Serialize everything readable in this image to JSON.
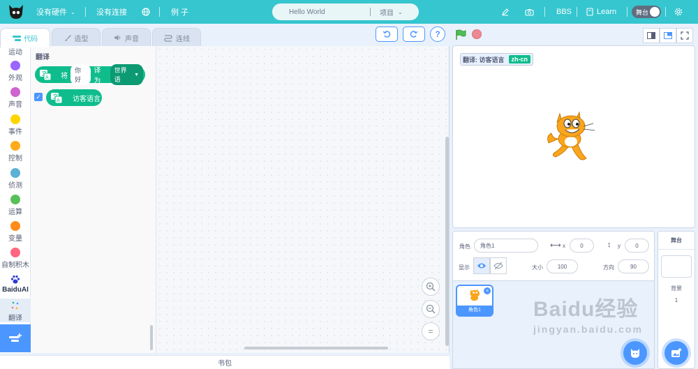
{
  "menu": {
    "hardware_label": "没有硬件",
    "connection_label": "没有连接",
    "examples_label": "例 子",
    "project_title": "Hello World",
    "project_menu_label": "项目",
    "bbs_label": "BBS",
    "learn_label": "Learn",
    "stage_toggle_label": "舞台"
  },
  "tabs": [
    {
      "label": "代码"
    },
    {
      "label": "造型"
    },
    {
      "label": "声音"
    },
    {
      "label": "连线"
    }
  ],
  "categories": [
    {
      "label": "运动",
      "color": "#4c97ff"
    },
    {
      "label": "外观",
      "color": "#9966ff"
    },
    {
      "label": "声音",
      "color": "#cf63cf"
    },
    {
      "label": "事件",
      "color": "#ffd500"
    },
    {
      "label": "控制",
      "color": "#ffab19"
    },
    {
      "label": "侦测",
      "color": "#5cb1d6"
    },
    {
      "label": "运算",
      "color": "#59c059"
    },
    {
      "label": "变量",
      "color": "#ff8c1a"
    },
    {
      "label": "自制积木",
      "color": "#ff6680"
    },
    {
      "label": "BaiduAI"
    },
    {
      "label": "翻译"
    }
  ],
  "palette": {
    "section_title": "翻译",
    "block1": {
      "prefix": "将",
      "input": "你好",
      "middle": "译为",
      "dropdown": "世界语"
    },
    "block2": {
      "label": "访客语言"
    }
  },
  "stage": {
    "monitor_label": "翻译: 访客语言",
    "monitor_value": "zh-cn"
  },
  "sprite_info": {
    "sprite_label": "角色",
    "sprite_name": "角色1",
    "x_label": "x",
    "x_value": "0",
    "y_label": "y",
    "y_value": "0",
    "show_label": "显示",
    "size_label": "大小",
    "size_value": "100",
    "direction_label": "方向",
    "direction_value": "90"
  },
  "sprite_list": [
    {
      "name": "角色1"
    }
  ],
  "stage_panel": {
    "title": "舞台",
    "backdrop_label": "背景",
    "backdrop_count": "1"
  },
  "backpack_label": "书包",
  "watermark": {
    "brand": "Baidu经验",
    "url": "jingyan.baidu.com"
  }
}
